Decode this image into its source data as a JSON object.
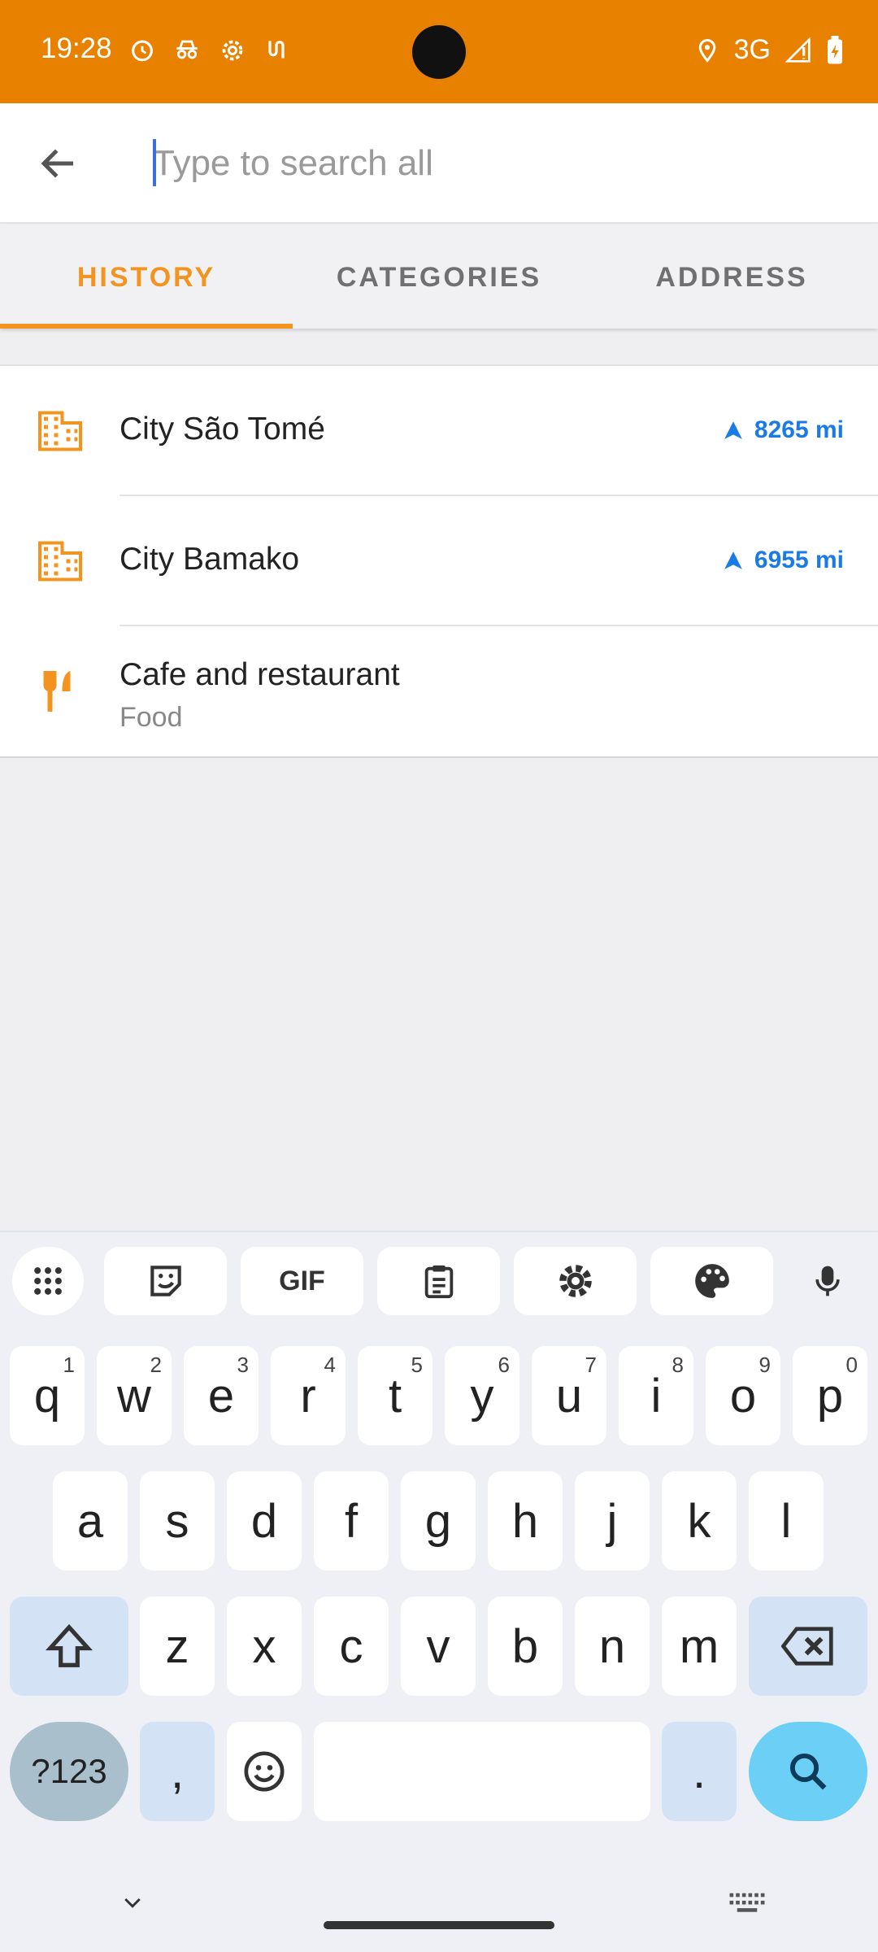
{
  "status_bar": {
    "time": "19:28",
    "network": "3G"
  },
  "search": {
    "placeholder": "Type to search all",
    "value": ""
  },
  "tabs": [
    {
      "label": "HISTORY",
      "active": true
    },
    {
      "label": "CATEGORIES",
      "active": false
    },
    {
      "label": "ADDRESS",
      "active": false
    }
  ],
  "history": [
    {
      "title": "City São Tomé",
      "distance": "8265 mi",
      "icon": "building-icon"
    },
    {
      "title": "City Bamako",
      "distance": "6955 mi",
      "icon": "building-icon"
    },
    {
      "title": "Cafe and restaurant",
      "subtitle": "Food",
      "icon": "fork-knife-icon"
    }
  ],
  "keyboard": {
    "toolbar": [
      "apps-icon",
      "sticker-icon",
      "GIF",
      "clipboard-icon",
      "settings-icon",
      "palette-icon",
      "mic-icon"
    ],
    "row1": [
      {
        "key": "q",
        "hint": "1"
      },
      {
        "key": "w",
        "hint": "2"
      },
      {
        "key": "e",
        "hint": "3"
      },
      {
        "key": "r",
        "hint": "4"
      },
      {
        "key": "t",
        "hint": "5"
      },
      {
        "key": "y",
        "hint": "6"
      },
      {
        "key": "u",
        "hint": "7"
      },
      {
        "key": "i",
        "hint": "8"
      },
      {
        "key": "o",
        "hint": "9"
      },
      {
        "key": "p",
        "hint": "0"
      }
    ],
    "row2": [
      "a",
      "s",
      "d",
      "f",
      "g",
      "h",
      "j",
      "k",
      "l"
    ],
    "row3": [
      "z",
      "x",
      "c",
      "v",
      "b",
      "n",
      "m"
    ],
    "row4": {
      "symbols": "?123",
      "comma": ",",
      "period": "."
    }
  },
  "colors": {
    "accent": "#f39420",
    "status_bar": "#e88100",
    "distance": "#1a7be8",
    "search_key": "#6ccff6"
  }
}
